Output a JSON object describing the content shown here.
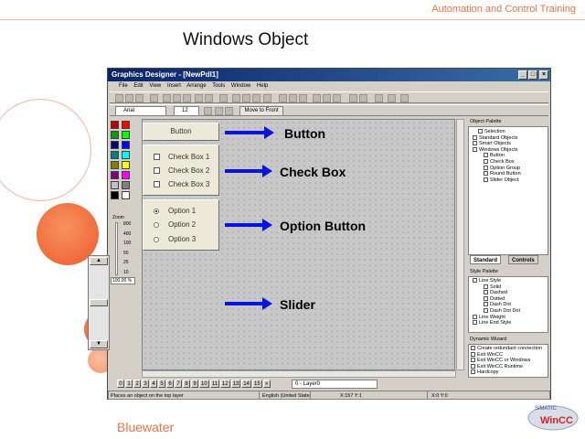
{
  "slide": {
    "header": "Automation and Control Training",
    "title": "Windows Object",
    "footer": "Bluewater",
    "logo_top": "SIMATIC",
    "logo_bottom": "WinCC"
  },
  "window": {
    "title": "Graphics Designer - [NewPdl1]",
    "controls": [
      "_",
      "□",
      "×"
    ],
    "menu": [
      "File",
      "Edit",
      "View",
      "Insert",
      "Arrange",
      "Tools",
      "Window",
      "Help"
    ],
    "font_name": "Arial",
    "font_size": "12",
    "move_front": "Move to Front"
  },
  "canvas": {
    "button_label": "Button",
    "checkboxes": [
      "Check Box 1",
      "Check Box 2",
      "Check Box 3"
    ],
    "options": [
      "Option 1",
      "Option 2",
      "Option 3"
    ],
    "selected_option": "Option 1"
  },
  "callouts": {
    "button": "Button",
    "checkbox": "Check Box",
    "option": "Option Button",
    "slider": "Slider"
  },
  "zoom": {
    "label": "Zoom",
    "levels": [
      "800",
      "400",
      "100",
      "50",
      "25",
      "10"
    ],
    "value": "100.00 %"
  },
  "object_palette": {
    "title": "Object Palette",
    "items": [
      "Selection",
      "Standard Objects",
      "Smart Objects",
      "Windows Objects",
      "Button",
      "Check Box",
      "Option Group",
      "Round Button",
      "Slider Object"
    ],
    "tabs": [
      "Standard",
      "Controls"
    ]
  },
  "style_palette": {
    "title": "Style Palette",
    "items": [
      "Line Style",
      "Solid",
      "Dashed",
      "Dotted",
      "Dash Dot",
      "Dash Dot Dot",
      "Line Weight",
      "Line End Style"
    ]
  },
  "dynamic_wizard": {
    "title": "Dynamic Wizard",
    "items": [
      "Create redundant connection",
      "Exit WinCC",
      "Exit WinCC or Windows",
      "Exit WinCC Runtime",
      "Hardcopy"
    ]
  },
  "layers": {
    "buttons": [
      "0",
      "1",
      "2",
      "3",
      "4",
      "5",
      "6",
      "7",
      "8",
      "9",
      "10",
      "11",
      "12",
      "13",
      "14",
      "15",
      "»"
    ],
    "current": "0 - Layer0"
  },
  "status": {
    "hint": "Places an object on the top layer",
    "language": "English (United States)",
    "pos": "X:157 Y:1",
    "size": "X:0 Y:0"
  },
  "colors": {
    "accent": "#e8744a",
    "arrow": "#0a14e0",
    "titlebar": "#0a246a",
    "palette": [
      "#c00000",
      "#ff0000",
      "#00a000",
      "#00ff00",
      "#000080",
      "#0000ff",
      "#008080",
      "#00ffff",
      "#808000",
      "#ffff00",
      "#800080",
      "#ff00ff",
      "#c0c0c0",
      "#808080",
      "#000000",
      "#ffffff"
    ]
  }
}
